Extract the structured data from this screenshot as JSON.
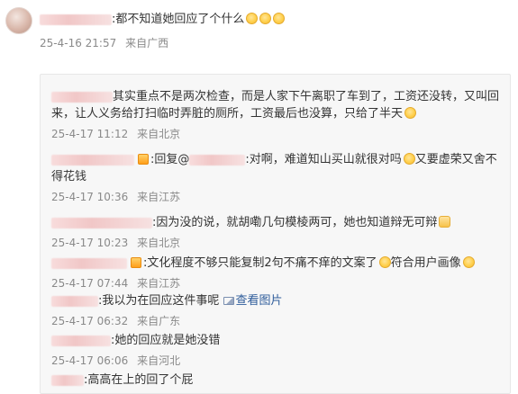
{
  "top_comment": {
    "text": ":都不知道她回应了个什么",
    "time": "25-4-16 21:57",
    "source": "来自广西"
  },
  "replies": [
    {
      "text": "其实重点不是两次检查，而是人家下午离职了车到了，工资还没转，又叫回来，让人义务给打扫临时弄脏的厕所，工资最后也没算，只给了半天",
      "time": "25-4-17 11:12",
      "source": "来自北京"
    },
    {
      "prefix": ":回复@",
      "text": ":对啊，难道知山买山就很对吗",
      "text2": "又要虚荣又舍不得花钱",
      "time": "25-4-17 10:36",
      "source": "来自江苏"
    },
    {
      "text": ":因为没的说，就胡嘞几句模棱两可，她也知道辩无可辩",
      "time": "25-4-17 10:23",
      "source": "来自北京"
    },
    {
      "text": ":文化程度不够只能复制2句不痛不痒的文案了",
      "text2": "符合用户画像",
      "time": "25-4-17 07:44",
      "source": "来自江苏"
    },
    {
      "text": ":我以为在回应这件事呢",
      "link": "查看图片",
      "time": "25-4-17 06:32",
      "source": "来自广东"
    },
    {
      "text": ":她的回应就是她没错",
      "time": "25-4-17 06:06",
      "source": "来自河北"
    },
    {
      "text": ":高高在上的回了个屁"
    }
  ]
}
